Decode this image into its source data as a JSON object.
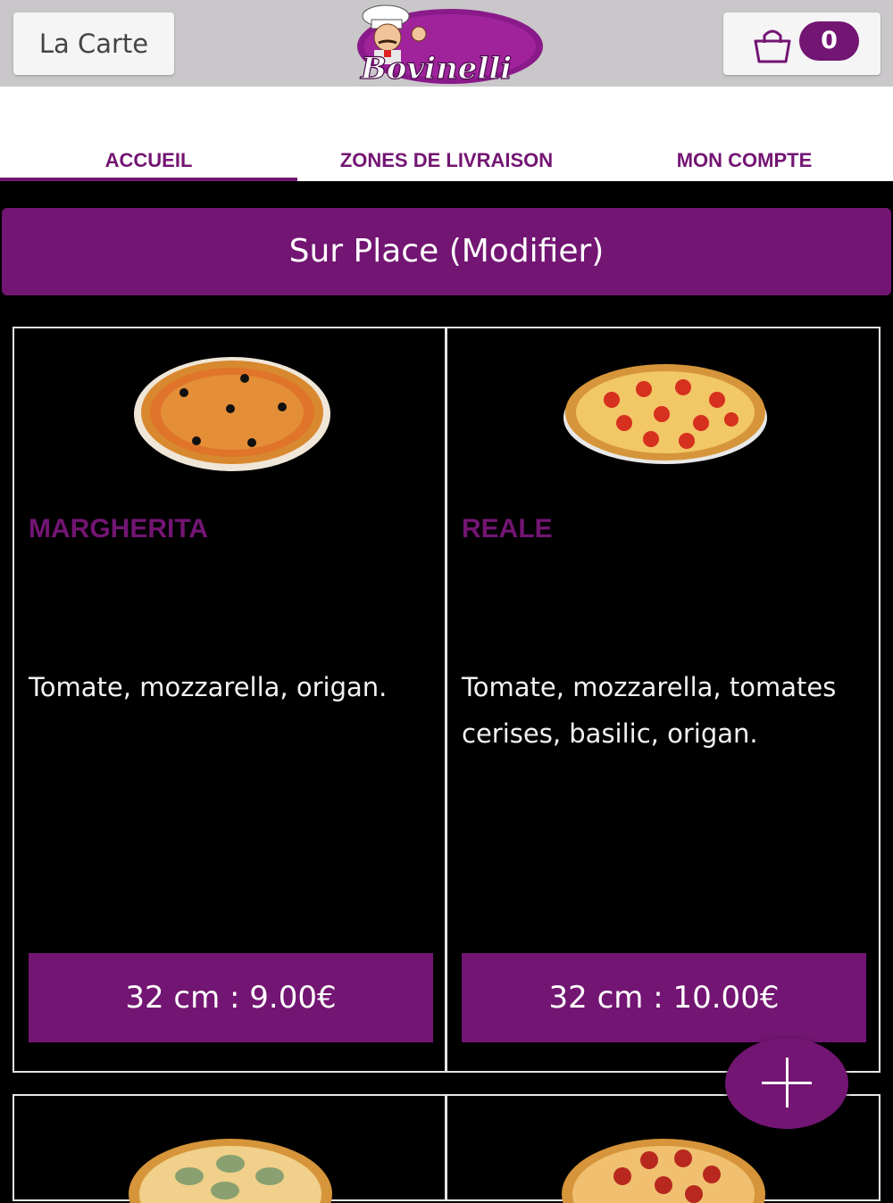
{
  "header": {
    "menu_button_label": "La Carte",
    "cart_count": "0",
    "logo_text": "Bovinelli"
  },
  "nav": {
    "tabs": [
      {
        "label": "ACCUEIL",
        "active": true
      },
      {
        "label": "ZONES DE LIVRAISON",
        "active": false
      },
      {
        "label": "MON COMPTE",
        "active": false
      }
    ]
  },
  "mode_button_label": "Sur Place (Modifier)",
  "products": [
    {
      "name": "MARGHERITA",
      "description": "Tomate, mozzarella, origan.",
      "price_label": "32 cm : 9.00€"
    },
    {
      "name": "REALE",
      "description": "Tomate, mozzarella, tomates cerises, basilic, origan.",
      "price_label": "32 cm : 10.00€"
    }
  ],
  "colors": {
    "accent": "#731573",
    "background": "#000000",
    "header_bg": "#c9c7c9"
  },
  "icons": {
    "cart": "shopping-bag-icon",
    "fab": "plus-icon"
  }
}
